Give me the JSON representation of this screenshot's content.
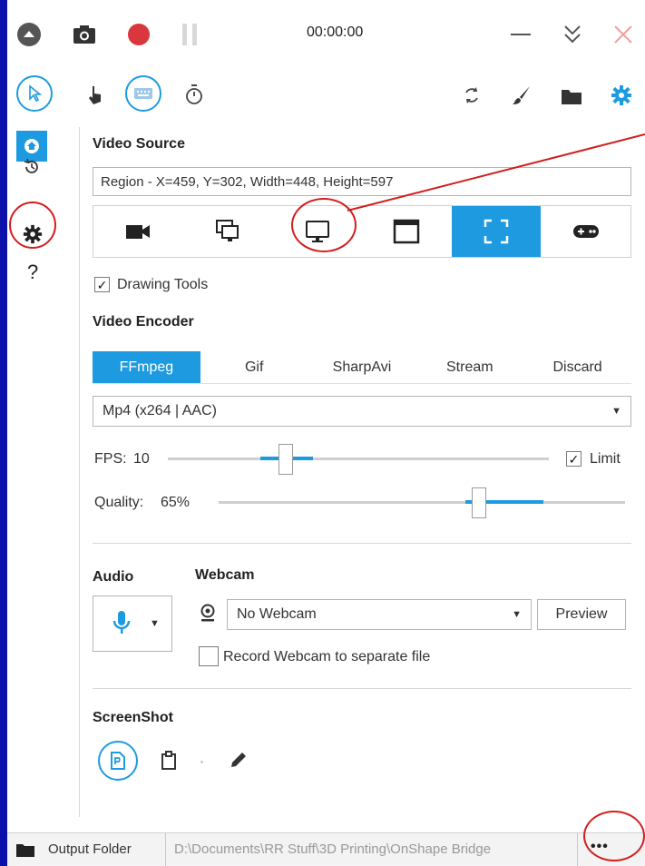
{
  "titlebar": {
    "timer": "00:00:00"
  },
  "video_source": {
    "title": "Video Source",
    "region_text": "Region - X=459, Y=302, Width=448, Height=597",
    "active_source_index": 4
  },
  "drawing_tools": {
    "label": "Drawing Tools",
    "checked": true
  },
  "video_encoder": {
    "title": "Video Encoder",
    "tabs": [
      "FFmpeg",
      "Gif",
      "SharpAvi",
      "Stream",
      "Discard"
    ],
    "active_tab": "FFmpeg",
    "codec": "Mp4 (x264 | AAC)"
  },
  "fps": {
    "label": "FPS:",
    "value": "10",
    "limit_label": "Limit",
    "limit_checked": true
  },
  "quality": {
    "label": "Quality:",
    "value": "65%"
  },
  "audio": {
    "title": "Audio"
  },
  "webcam": {
    "title": "Webcam",
    "selected": "No Webcam",
    "preview_label": "Preview",
    "separate_file_label": "Record Webcam to separate file",
    "separate_file_checked": false
  },
  "screenshot": {
    "title": "ScreenShot"
  },
  "status": {
    "output_folder_label": "Output Folder",
    "output_path": "D:\\Documents\\RR Stuff\\3D Printing\\OnShape Bridge",
    "more_label": "•••"
  },
  "colors": {
    "accent": "#1e9be0",
    "record": "#d9363e",
    "annotation": "#d21e1e",
    "background": "#0a10a8"
  }
}
